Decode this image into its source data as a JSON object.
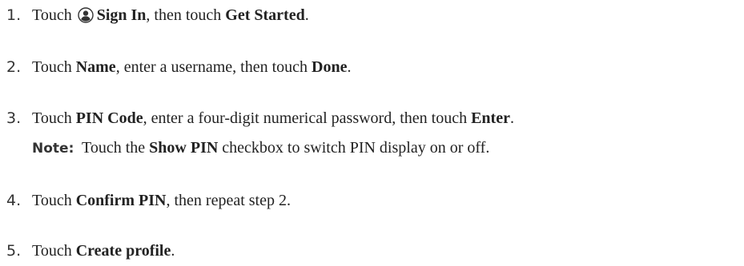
{
  "steps": [
    {
      "number": "1.",
      "parts": {
        "a": "Touch",
        "b": "Sign In",
        "c": ", then touch",
        "d": "Get Started",
        "e": "."
      }
    },
    {
      "number": "2.",
      "parts": {
        "a": "Touch",
        "b": "Name",
        "c": ", enter a username, then touch",
        "d": "Done",
        "e": "."
      }
    },
    {
      "number": "3.",
      "parts": {
        "a": "Touch",
        "b": "PIN Code",
        "c": ", enter a four-digit numerical password, then touch",
        "d": "Enter",
        "e": "."
      }
    },
    {
      "number": "4.",
      "parts": {
        "a": "Touch",
        "b": "Confirm PIN",
        "c": ", then repeat step 2."
      }
    },
    {
      "number": "5.",
      "parts": {
        "a": "Touch",
        "b": "Create profile",
        "c": "."
      }
    }
  ],
  "note": {
    "label": "Note:",
    "a": "Touch the",
    "b": "Show PIN",
    "c": "checkbox to switch PIN display on or off."
  },
  "icons": {
    "sign_in": "account-circle-icon"
  }
}
